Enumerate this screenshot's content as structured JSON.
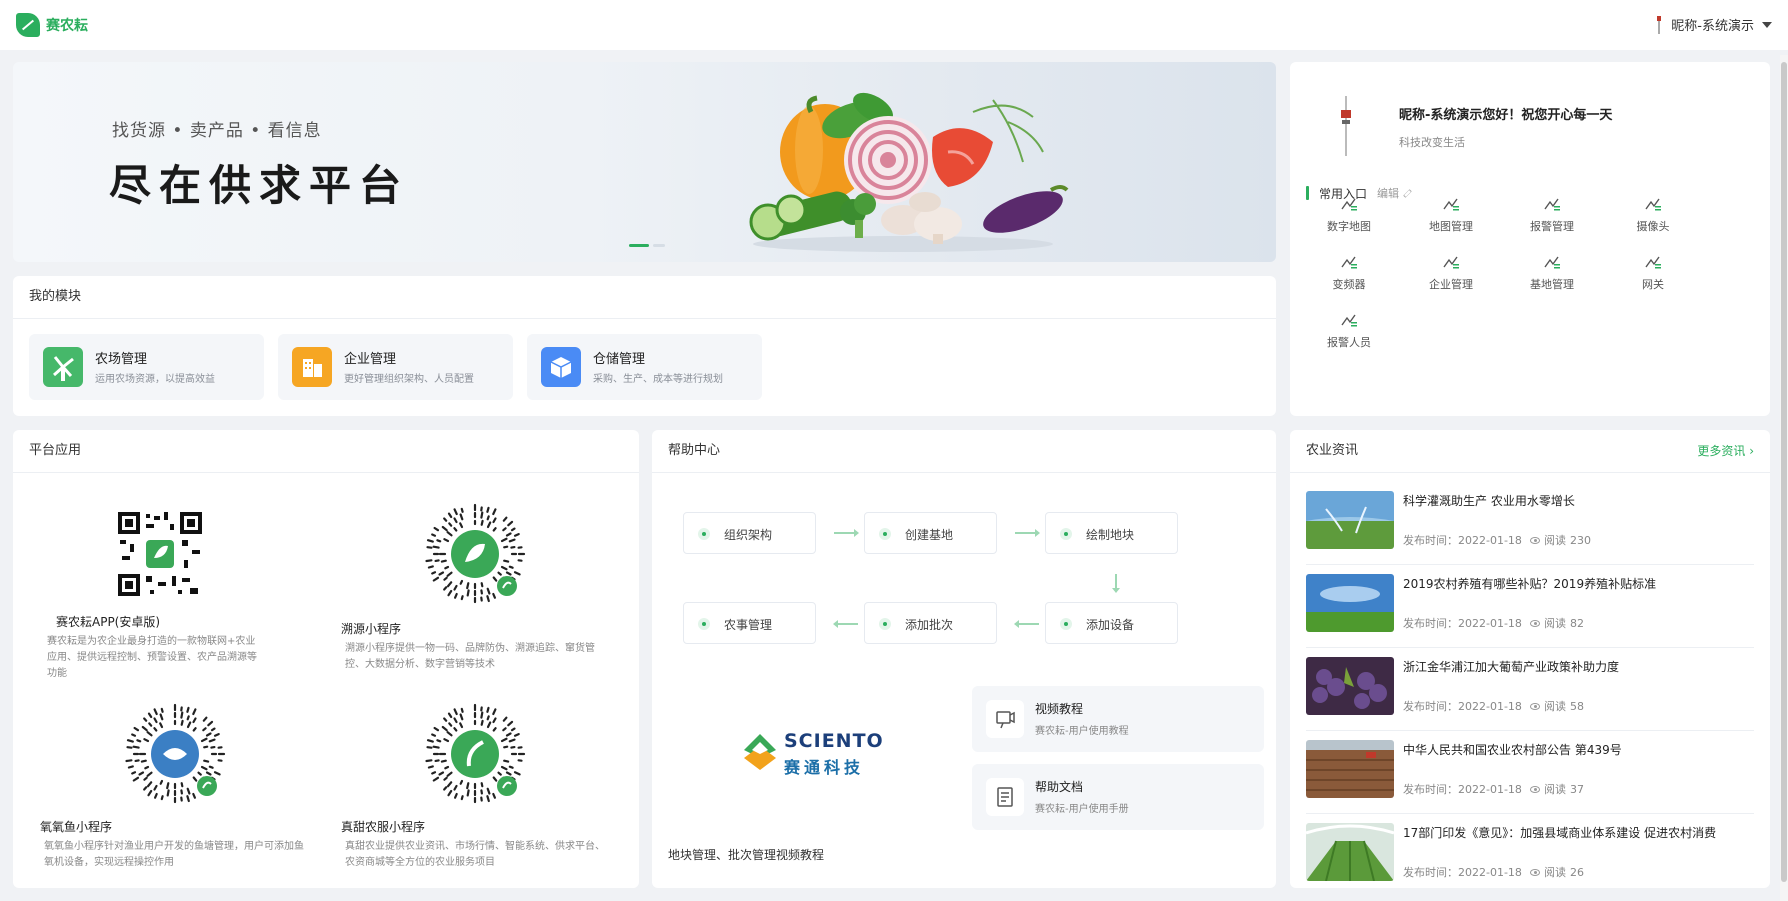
{
  "app": {
    "logo_text": "赛农耘",
    "user_name": "昵称-系统演示"
  },
  "banner": {
    "subtitle": "找货源 • 卖产品 • 看信息",
    "title": "尽在供求平台"
  },
  "modules": {
    "title": "我的模块",
    "items": [
      {
        "name": "农场管理",
        "desc": "运用农场资源，以提高效益",
        "color": "#46b86a",
        "icon": "windmill-icon"
      },
      {
        "name": "企业管理",
        "desc": "更好管理组织架构、人员配置",
        "color": "#f6a623",
        "icon": "building-icon"
      },
      {
        "name": "仓储管理",
        "desc": "采购、生产、成本等进行规划",
        "color": "#4a8bf5",
        "icon": "box-icon"
      }
    ]
  },
  "usercard": {
    "greeting": "昵称-系统演示您好！祝您开心每一天",
    "motto": "科技改变生活",
    "quick_title": "常用入口",
    "edit_label": "编辑",
    "quick_items": [
      "数字地图",
      "地图管理",
      "报警管理",
      "摄像头",
      "变频器",
      "企业管理",
      "基地管理",
      "网关",
      "报警人员"
    ]
  },
  "apps": {
    "title": "平台应用",
    "items": [
      {
        "name": "赛农耘APP(安卓版)",
        "desc": "赛农耘是为农企业最身打造的一款物联网+农业应用、提供远程控制、预警设置、农产品溯源等功能"
      },
      {
        "name": "溯源小程序",
        "desc": "溯源小程序提供一物一码、品牌防伪、溯源追踪、窜货管控、大数据分析、数字营销等技术"
      },
      {
        "name": "氧氧鱼小程序",
        "desc": "氧氧鱼小程序针对渔业用户开发的鱼塘管理，用户可添加鱼氧机设备，实现远程操控作用"
      },
      {
        "name": "真甜农服小程序",
        "desc": "真甜农业提供农业资讯、市场行情、智能系统、供求平台、农资商城等全方位的农业服务项目"
      }
    ]
  },
  "help": {
    "title": "帮助中心",
    "steps": [
      "组织架构",
      "创建基地",
      "绘制地块",
      "农事管理",
      "添加批次",
      "添加设备"
    ],
    "brand_en": "SCIENTO",
    "brand_cn": "赛通科技",
    "cards": [
      {
        "title": "视频教程",
        "sub": "赛农耘-用户使用教程"
      },
      {
        "title": "帮助文档",
        "sub": "赛农耘-用户使用手册"
      }
    ],
    "footer": "地块管理、批次管理视频教程"
  },
  "news": {
    "title": "农业资讯",
    "more": "更多资讯",
    "date_label": "发布时间：",
    "reads_label": "阅读",
    "items": [
      {
        "title": "科学灌溉助生产 农业用水零增长",
        "date": "2022-01-18",
        "reads": "230"
      },
      {
        "title": "2019农村养殖有哪些补贴？2019养殖补贴标准",
        "date": "2022-01-18",
        "reads": "82"
      },
      {
        "title": "浙江金华浦江加大葡萄产业政策补助力度",
        "date": "2022-01-18",
        "reads": "58"
      },
      {
        "title": "中华人民共和国农业农村部公告 第439号",
        "date": "2022-01-18",
        "reads": "37"
      },
      {
        "title": "17部门印发《意见》：加强县域商业体系建设 促进农村消费",
        "date": "2022-01-18",
        "reads": "26"
      }
    ]
  },
  "colors": {
    "accent": "#2bae5e",
    "background": "#f0f2f5"
  }
}
